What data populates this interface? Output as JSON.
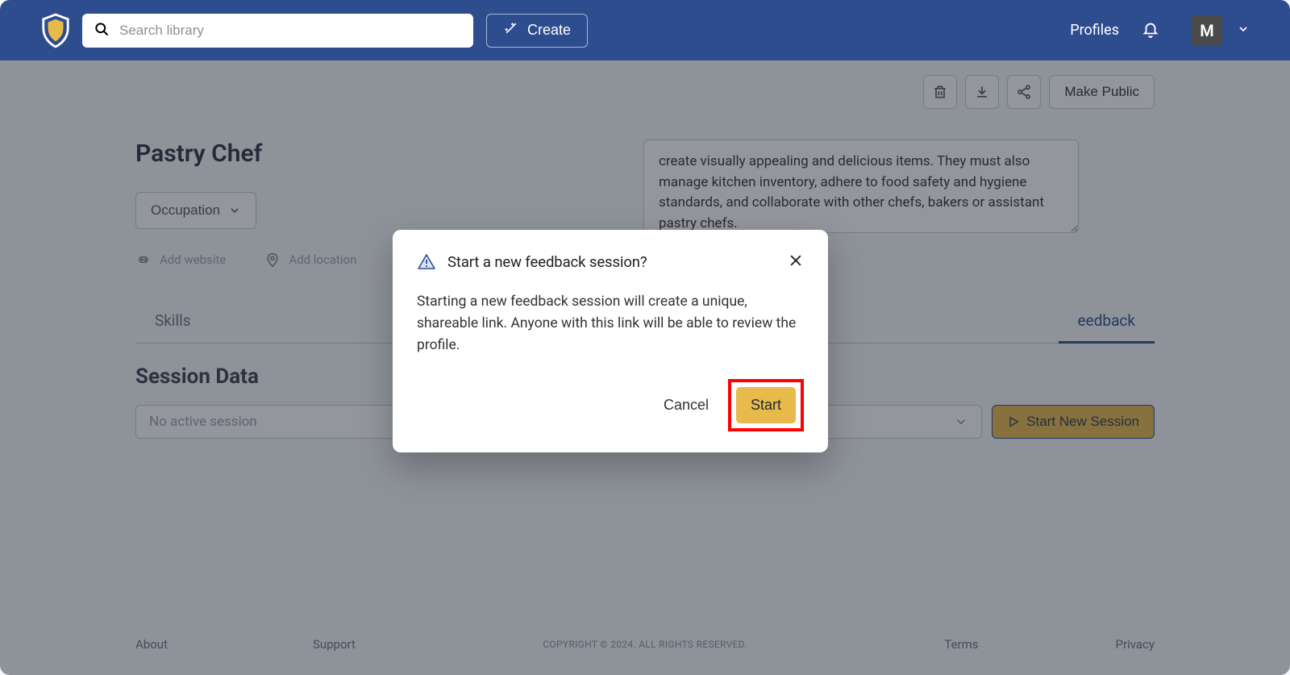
{
  "header": {
    "search_placeholder": "Search library",
    "create_label": "Create",
    "profiles_label": "Profiles",
    "avatar_initial": "M"
  },
  "actions": {
    "make_public_label": "Make Public"
  },
  "profile": {
    "title": "Pastry Chef",
    "occupation_label": "Occupation",
    "add_website_label": "Add website",
    "add_location_label": "Add location",
    "description": "create visually appealing and delicious items. They must also manage kitchen inventory, adhere to food safety and hygiene standards, and collaborate with other chefs, bakers or assistant pastry chefs."
  },
  "tabs": {
    "skills": "Skills",
    "feedback": "eedback"
  },
  "session": {
    "heading": "Session Data",
    "placeholder": "No active session",
    "start_new_label": "Start New Session"
  },
  "footer": {
    "about": "About",
    "support": "Support",
    "copyright": "COPYRIGHT © 2024. ALL RIGHTS RESERVED.",
    "terms": "Terms",
    "privacy": "Privacy"
  },
  "dialog": {
    "title": "Start a new feedback session?",
    "body": "Starting a new feedback session will create a unique, shareable link. Anyone with this link will be able to review the profile.",
    "cancel_label": "Cancel",
    "start_label": "Start"
  }
}
